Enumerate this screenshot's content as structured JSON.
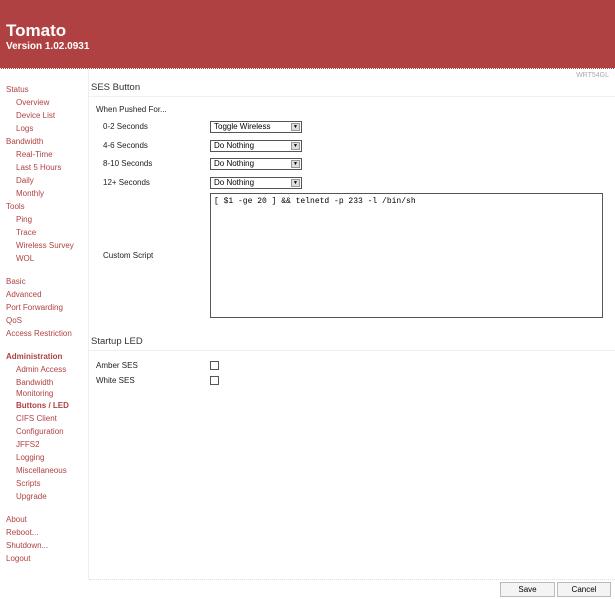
{
  "header": {
    "title": "Tomato",
    "version": "Version 1.02.0931",
    "model": "WRT54GL"
  },
  "sidebar": [
    {
      "label": "Status",
      "indent": false,
      "bold": false
    },
    {
      "label": "Overview",
      "indent": true
    },
    {
      "label": "Device List",
      "indent": true
    },
    {
      "label": "Logs",
      "indent": true
    },
    {
      "label": "Bandwidth",
      "indent": false
    },
    {
      "label": "Real-Time",
      "indent": true
    },
    {
      "label": "Last 5 Hours",
      "indent": true
    },
    {
      "label": "Daily",
      "indent": true
    },
    {
      "label": "Monthly",
      "indent": true
    },
    {
      "label": "Tools",
      "indent": false
    },
    {
      "label": "Ping",
      "indent": true
    },
    {
      "label": "Trace",
      "indent": true
    },
    {
      "label": "Wireless Survey",
      "indent": true
    },
    {
      "label": "WOL",
      "indent": true
    },
    {
      "label": "Basic",
      "indent": false,
      "gap": true
    },
    {
      "label": "Advanced",
      "indent": false
    },
    {
      "label": "Port Forwarding",
      "indent": false
    },
    {
      "label": "QoS",
      "indent": false
    },
    {
      "label": "Access Restriction",
      "indent": false
    },
    {
      "label": "Administration",
      "indent": false,
      "bold": true,
      "gap": true
    },
    {
      "label": "Admin Access",
      "indent": true
    },
    {
      "label": "Bandwidth Monitoring",
      "indent": true,
      "two": true
    },
    {
      "label": "Buttons / LED",
      "indent": true,
      "bold": true
    },
    {
      "label": "CIFS Client",
      "indent": true
    },
    {
      "label": "Configuration",
      "indent": true
    },
    {
      "label": "JFFS2",
      "indent": true
    },
    {
      "label": "Logging",
      "indent": true
    },
    {
      "label": "Miscellaneous",
      "indent": true
    },
    {
      "label": "Scripts",
      "indent": true
    },
    {
      "label": "Upgrade",
      "indent": true
    },
    {
      "label": "About",
      "indent": false,
      "gap": true
    },
    {
      "label": "Reboot...",
      "indent": false
    },
    {
      "label": "Shutdown...",
      "indent": false
    },
    {
      "label": "Logout",
      "indent": false
    }
  ],
  "ses": {
    "title": "SES Button",
    "when": "When Pushed For...",
    "rows": [
      {
        "label": "0-2 Seconds",
        "value": "Toggle Wireless"
      },
      {
        "label": "4-6 Seconds",
        "value": "Do Nothing"
      },
      {
        "label": "8-10 Seconds",
        "value": "Do Nothing"
      },
      {
        "label": "12+ Seconds",
        "value": "Do Nothing"
      }
    ],
    "script_label": "Custom Script",
    "script": "[ $1 -ge 20 ] && telnetd -p 233 -l /bin/sh"
  },
  "led": {
    "title": "Startup LED",
    "amber": "Amber SES",
    "white": "White SES",
    "amber_checked": false,
    "white_checked": false
  },
  "buttons": {
    "save": "Save",
    "cancel": "Cancel"
  },
  "colors": {
    "brand": "#b04142"
  }
}
